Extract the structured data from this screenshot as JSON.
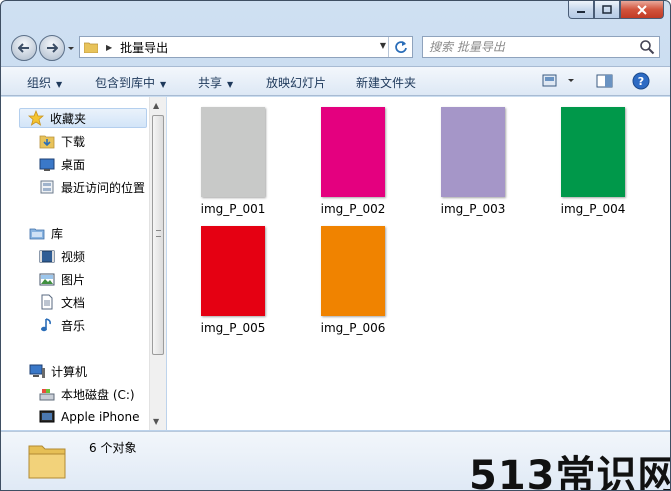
{
  "window": {
    "title": "批量导出"
  },
  "caption_buttons": {
    "minimize": "▁",
    "maximize": "▢",
    "close": "✕"
  },
  "address": {
    "path": "批量导出"
  },
  "search": {
    "placeholder": "搜索 批量导出"
  },
  "toolbar": {
    "organize": "组织",
    "include_in_library": "包含到库中",
    "share": "共享",
    "slideshow": "放映幻灯片",
    "new_folder": "新建文件夹"
  },
  "sidebar": {
    "favorites": {
      "label": "收藏夹",
      "items": [
        "下载",
        "桌面",
        "最近访问的位置"
      ]
    },
    "libraries": {
      "label": "库",
      "items": [
        "视频",
        "图片",
        "文档",
        "音乐"
      ]
    },
    "computer": {
      "label": "计算机",
      "items": [
        "本地磁盘 (C:)",
        "Apple iPhone"
      ]
    }
  },
  "files": [
    {
      "name": "img_P_001",
      "color": "#c8c9c8"
    },
    {
      "name": "img_P_002",
      "color": "#e4007f"
    },
    {
      "name": "img_P_003",
      "color": "#a596c8"
    },
    {
      "name": "img_P_004",
      "color": "#00984a"
    },
    {
      "name": "img_P_005",
      "color": "#e50012"
    },
    {
      "name": "img_P_006",
      "color": "#f08300"
    }
  ],
  "status": {
    "count_text": "6 个对象"
  },
  "watermark": "513常识网"
}
